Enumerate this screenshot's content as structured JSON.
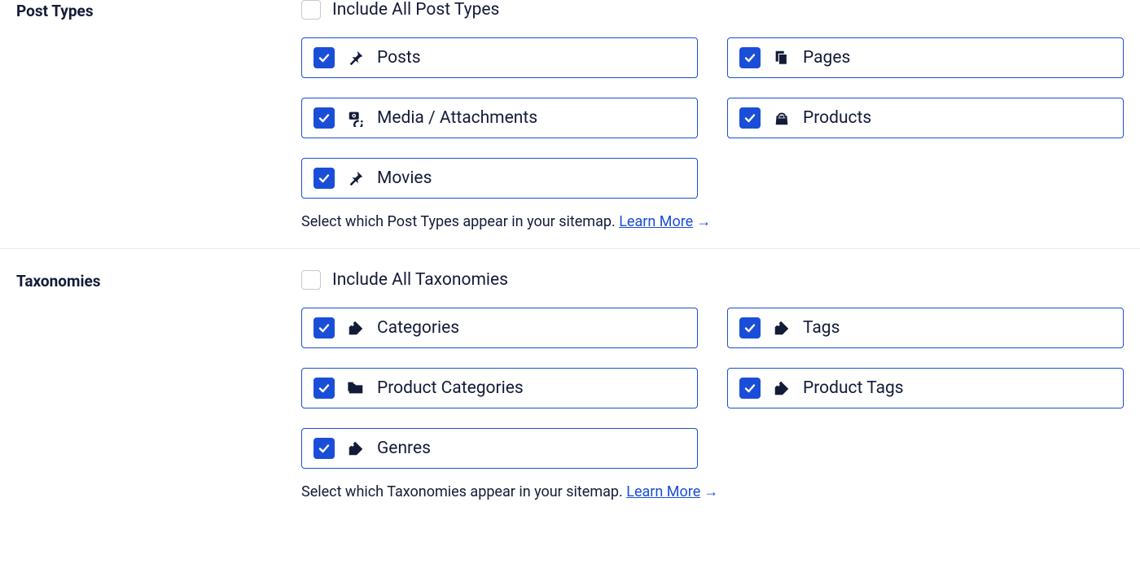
{
  "postTypes": {
    "heading": "Post Types",
    "includeAllLabel": "Include All Post Types",
    "includeAllChecked": false,
    "items": [
      {
        "label": "Posts",
        "icon": "pin",
        "checked": true
      },
      {
        "label": "Pages",
        "icon": "pages",
        "checked": true
      },
      {
        "label": "Media / Attachments",
        "icon": "media",
        "checked": true
      },
      {
        "label": "Products",
        "icon": "bag",
        "checked": true
      },
      {
        "label": "Movies",
        "icon": "pin",
        "checked": true
      }
    ],
    "helperText": "Select which Post Types appear in your sitemap.",
    "learnMore": "Learn More"
  },
  "taxonomies": {
    "heading": "Taxonomies",
    "includeAllLabel": "Include All Taxonomies",
    "includeAllChecked": false,
    "items": [
      {
        "label": "Categories",
        "icon": "tag",
        "checked": true
      },
      {
        "label": "Tags",
        "icon": "tag",
        "checked": true
      },
      {
        "label": "Product Categories",
        "icon": "folder",
        "checked": true
      },
      {
        "label": "Product Tags",
        "icon": "tag",
        "checked": true
      },
      {
        "label": "Genres",
        "icon": "tag",
        "checked": true
      }
    ],
    "helperText": "Select which Taxonomies appear in your sitemap.",
    "learnMore": "Learn More"
  }
}
